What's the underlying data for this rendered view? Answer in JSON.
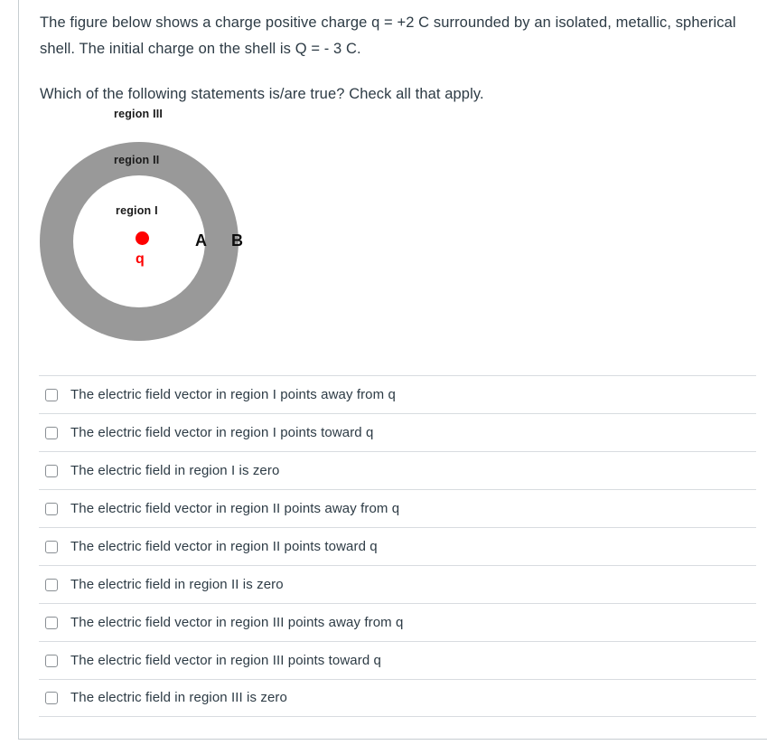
{
  "question": {
    "paragraph_1": "The figure below shows a charge positive charge q = +2 C surrounded by an isolated, metallic, spherical shell. The initial charge on the shell is Q = - 3 C.",
    "paragraph_2": "Which of the following statements is/are true? Check all that apply."
  },
  "figure": {
    "labels": {
      "region_3": "region III",
      "region_2": "region II",
      "region_1": "region I",
      "charge": "q",
      "point_a": "A",
      "point_b": "B"
    },
    "colors": {
      "shell": "#999999",
      "charge": "#fe0000",
      "cavity": "#ffffff"
    }
  },
  "answers": [
    {
      "label": "The electric field vector in region I points away from q",
      "checked": false
    },
    {
      "label": "The electric field vector in region I points toward q",
      "checked": false
    },
    {
      "label": "The electric field in region I is zero",
      "checked": false
    },
    {
      "label": "The electric field vector in region II points away from q",
      "checked": false
    },
    {
      "label": "The electric field vector in region II points toward q",
      "checked": false
    },
    {
      "label": "The electric field in region II is zero",
      "checked": false
    },
    {
      "label": "The electric field vector in region III points away from q",
      "checked": false
    },
    {
      "label": "The electric field vector in region III points toward q",
      "checked": false
    },
    {
      "label": "The electric field in region III is zero",
      "checked": false
    }
  ]
}
